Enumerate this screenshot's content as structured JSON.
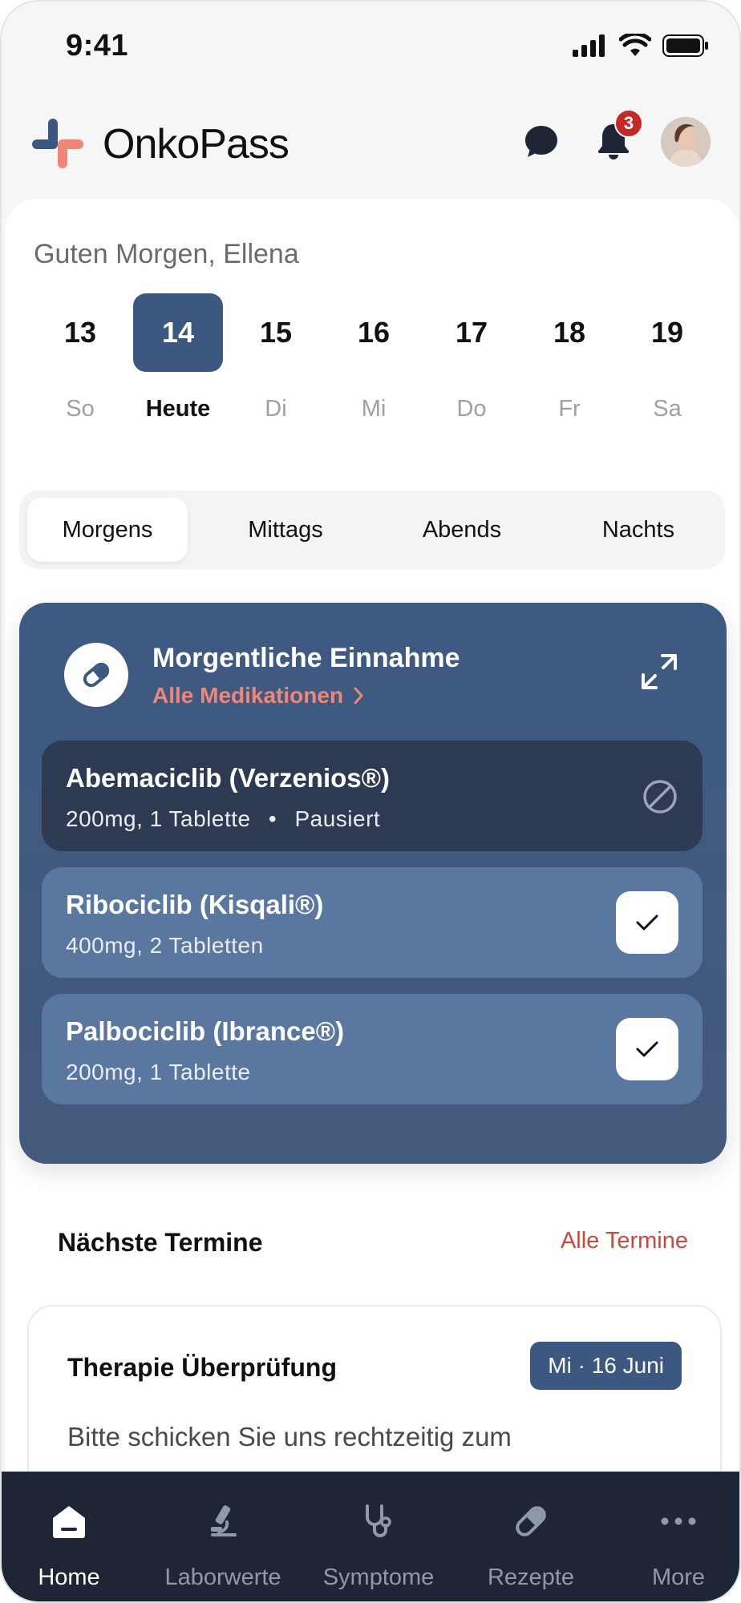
{
  "status_bar": {
    "time": "9:41"
  },
  "header": {
    "app_name": "OnkoPass",
    "notification_count": "3"
  },
  "greeting": "Guten Morgen, Ellena",
  "calendar": {
    "days": [
      {
        "num": "13",
        "label": "So",
        "active": false
      },
      {
        "num": "14",
        "label": "Heute",
        "active": true
      },
      {
        "num": "15",
        "label": "Di",
        "active": false
      },
      {
        "num": "16",
        "label": "Mi",
        "active": false
      },
      {
        "num": "17",
        "label": "Do",
        "active": false
      },
      {
        "num": "18",
        "label": "Fr",
        "active": false
      },
      {
        "num": "19",
        "label": "Sa",
        "active": false
      }
    ]
  },
  "segments": [
    "Morgens",
    "Mittags",
    "Abends",
    "Nachts"
  ],
  "selected_segment": "Morgens",
  "med_card": {
    "title": "Morgentliche Einnahme",
    "link": "Alle Medikationen",
    "items": [
      {
        "name": "Abemaciclib (Verzenios®)",
        "dose": "200mg, 1 Tablette",
        "status": "Pausiert",
        "state": "paused"
      },
      {
        "name": "Ribociclib (Kisqali®)",
        "dose": "400mg, 2 Tabletten",
        "state": "taken"
      },
      {
        "name": "Palbociclib (Ibrance®)",
        "dose": "200mg, 1 Tablette",
        "state": "taken"
      }
    ]
  },
  "appointments": {
    "title": "Nächste Termine",
    "link": "Alle Termine",
    "card": {
      "title": "Therapie Überprüfung",
      "date": "Mi · 16 Juni",
      "text": "Bitte schicken Sie uns rechtzeitig zum"
    }
  },
  "tabbar": [
    {
      "label": "Home",
      "icon": "home-icon",
      "active": true
    },
    {
      "label": "Laborwerte",
      "icon": "microscope-icon",
      "active": false
    },
    {
      "label": "Symptome",
      "icon": "stethoscope-icon",
      "active": false
    },
    {
      "label": "Rezepte",
      "icon": "pill-icon",
      "active": false
    },
    {
      "label": "More",
      "icon": "more-icon",
      "active": false
    }
  ],
  "colors": {
    "primary": "#3d5880",
    "accent": "#c94a3d",
    "tabbar": "#1e2636"
  }
}
